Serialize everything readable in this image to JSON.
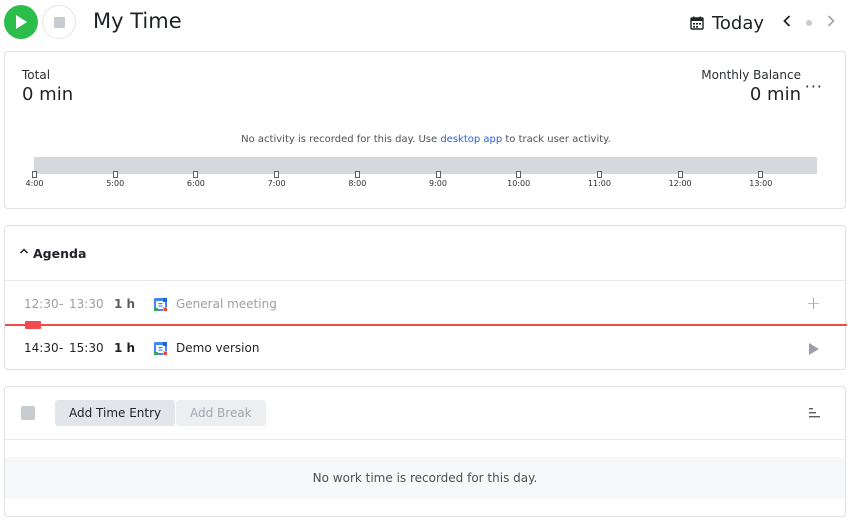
{
  "header": {
    "title": "My Time",
    "date_label": "Today",
    "prev_arrow": "‹",
    "next_arrow": "›"
  },
  "summary": {
    "total_label": "Total",
    "total_value": "0 min",
    "balance_label": "Monthly Balance",
    "balance_value": "0 min",
    "more_glyph": "···",
    "activity_message_prefix": "No activity is recorded for this day. Use ",
    "activity_link": "desktop app",
    "activity_message_suffix": " to track user activity.",
    "timeline_ticks": [
      "4:00",
      "5:00",
      "6:00",
      "7:00",
      "8:00",
      "9:00",
      "10:00",
      "11:00",
      "12:00",
      "13:00"
    ]
  },
  "agenda": {
    "title": "Agenda",
    "events": [
      {
        "start": "12:30",
        "separator": "-",
        "end": "13:30",
        "duration": "1 h",
        "title": "General meeting",
        "state": "past",
        "action_glyph": "+"
      },
      {
        "start": "14:30",
        "separator": "-",
        "end": "15:30",
        "duration": "1 h",
        "title": "Demo version",
        "state": "upcoming"
      }
    ]
  },
  "entries": {
    "add_entry_label": "Add Time Entry",
    "add_break_label": "Add Break",
    "empty_message": "No work time is recorded for this day."
  },
  "colors": {
    "accent_green": "#2dbd4a",
    "now_line_red": "#f14b4b",
    "link_blue": "#2b5fd9"
  }
}
